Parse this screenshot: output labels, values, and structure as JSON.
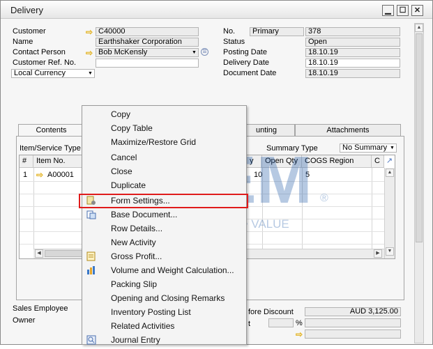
{
  "window": {
    "title": "Delivery"
  },
  "header": {
    "customer_label": "Customer",
    "customer_value": "C40000",
    "name_label": "Name",
    "name_value": "Earthshaker Corporation",
    "contact_label": "Contact Person",
    "contact_value": "Bob McKensly",
    "ref_label": "Customer Ref. No.",
    "ref_value": "",
    "currency_value": "Local Currency",
    "no_label": "No.",
    "series_value": "Primary",
    "no_value": "378",
    "status_label": "Status",
    "status_value": "Open",
    "posting_label": "Posting Date",
    "posting_value": "18.10.19",
    "delivery_label": "Delivery Date",
    "delivery_value": "18.10.19",
    "document_label": "Document Date",
    "document_value": "18.10.19"
  },
  "tabs": {
    "contents": "Contents",
    "accounting": "unting",
    "attachments": "Attachments"
  },
  "contents": {
    "item_type_label": "Item/Service Type",
    "summary_type_label": "Summary Type",
    "summary_type_value": "No Summary",
    "columns": {
      "hash": "#",
      "item_no": "Item No.",
      "qty_frag": "y",
      "open_qty": "Open Qty",
      "cogs": "COGS Region",
      "c": "C"
    },
    "row": {
      "num": "1",
      "item_no": "A00001",
      "qty": "10",
      "open_qty": "5"
    }
  },
  "footer": {
    "sales_employee_label": "Sales Employee",
    "owner_label": "Owner",
    "before_discount_label": "fore Discount",
    "before_discount_value": "AUD 3,125.00",
    "t_frag": "t",
    "pct": "%"
  },
  "context_menu": {
    "items": [
      "Copy",
      "Copy Table",
      "Maximize/Restore Grid",
      "Cancel",
      "Close",
      "Duplicate",
      "Form Settings...",
      "Base Document...",
      "Row Details...",
      "New Activity",
      "Gross Profit...",
      "Volume and Weight Calculation...",
      "Packing Slip",
      "Opening and Closing Remarks",
      "Inventory Posting List",
      "Related Activities",
      "Journal Entry"
    ]
  },
  "watermark": {
    "brand": "STEM",
    "tagline": "INNOVATION • DESIGN • VALUE",
    "reg": "®"
  },
  "colors": {
    "highlight_border": "#e01b1b",
    "link_arrow": "#e3b21f",
    "watermark": "#1f5aa8"
  }
}
